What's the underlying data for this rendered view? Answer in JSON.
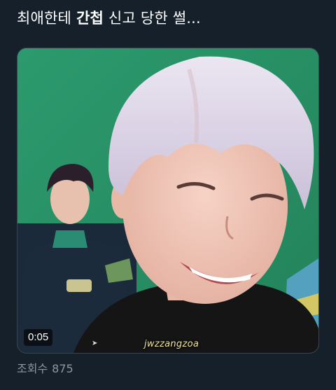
{
  "tweet": {
    "title_part1": "최애한테",
    "title_bold": "간첩",
    "title_part2": "신고 당한 썰...",
    "video": {
      "duration": "0:05",
      "watermark": "jwzzangzoa"
    },
    "views_label": "조회수",
    "views_count": "875"
  },
  "icons": {
    "cursor": "mouse-pointer-icon"
  },
  "colors": {
    "background": "#15202b",
    "text_primary": "#ffffff",
    "text_secondary": "#8b98a5",
    "media_border": "#38444d"
  }
}
